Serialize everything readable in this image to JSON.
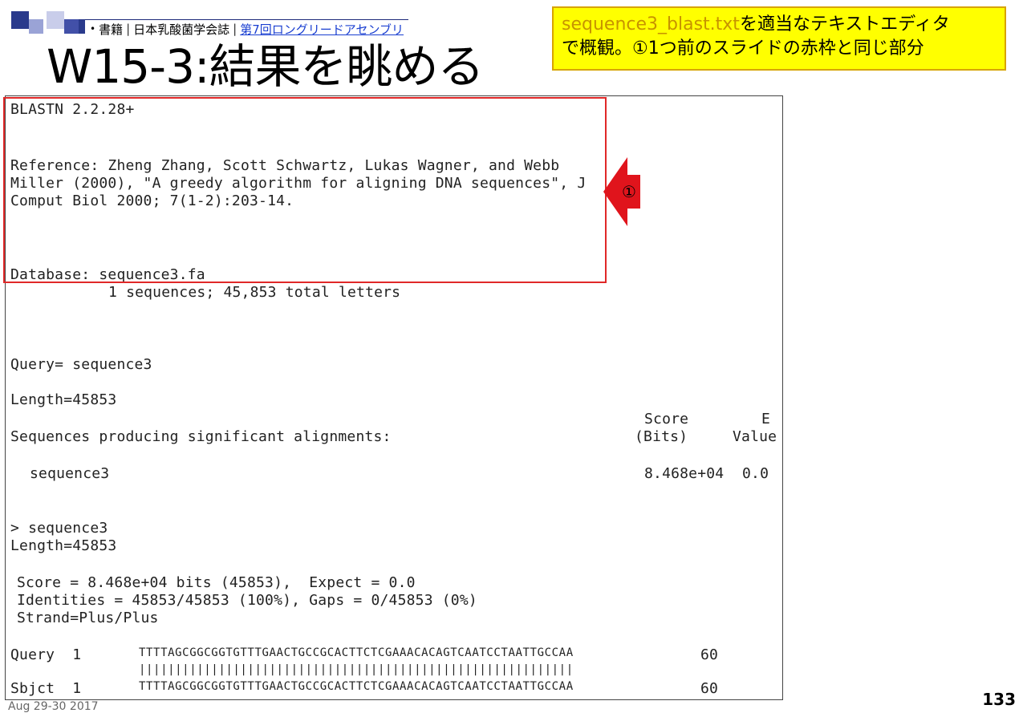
{
  "header": {
    "bullet": "•",
    "book": "書籍",
    "sep": "|",
    "society": "日本乳酸菌学会誌",
    "link": "第7回ロングリードアセンブリ"
  },
  "title": "W15-3:結果を眺める",
  "callout": {
    "filename": "sequence3_blast.txt",
    "line1_rest": "を適当なテキストエディタ",
    "line2": "で概観。①1つ前のスライドの赤枠と同じ部分"
  },
  "marker_label": "①",
  "blast": {
    "version": "BLASTN 2.2.28+",
    "reference_1": "Reference: Zheng Zhang, Scott Schwartz, Lukas Wagner, and Webb",
    "reference_2": "Miller (2000), \"A greedy algorithm for aligning DNA sequences\", J",
    "reference_3": "Comput Biol 2000; 7(1-2):203-14.",
    "database": "Database: sequence3.fa",
    "db_stats": "1 sequences; 45,853 total letters",
    "query": "Query= sequence3",
    "length": "Length=45853",
    "score_head": "Score",
    "e_head": "E",
    "seq_producing": "Sequences producing significant alignments:",
    "bits_head": "(Bits)",
    "value_head": "Value",
    "hit_name": "sequence3",
    "hit_score": "8.468e+04",
    "hit_e": "0.0",
    "subject": "> sequence3",
    "subject_length": "Length=45853",
    "score_line": "Score = 8.468e+04 bits (45853),  Expect = 0.0",
    "identities_line": "Identities = 45853/45853 (100%), Gaps = 0/45853 (0%)",
    "strand_line": "Strand=Plus/Plus",
    "query_label": "Query  1",
    "query_seq": "TTTTAGCGGCGGTGTTTGAACTGCCGCACTTCTCGAAACACAGTCAATCCTAATTGCCAA",
    "query_end": "60",
    "match_line": "||||||||||||||||||||||||||||||||||||||||||||||||||||||||||||",
    "sbjct_label": "Sbjct  1",
    "sbjct_seq": "TTTTAGCGGCGGTGTTTGAACTGCCGCACTTCTCGAAACACAGTCAATCCTAATTGCCAA",
    "sbjct_end": "60"
  },
  "footer": {
    "date": "Aug 29-30 2017",
    "page": "133"
  }
}
